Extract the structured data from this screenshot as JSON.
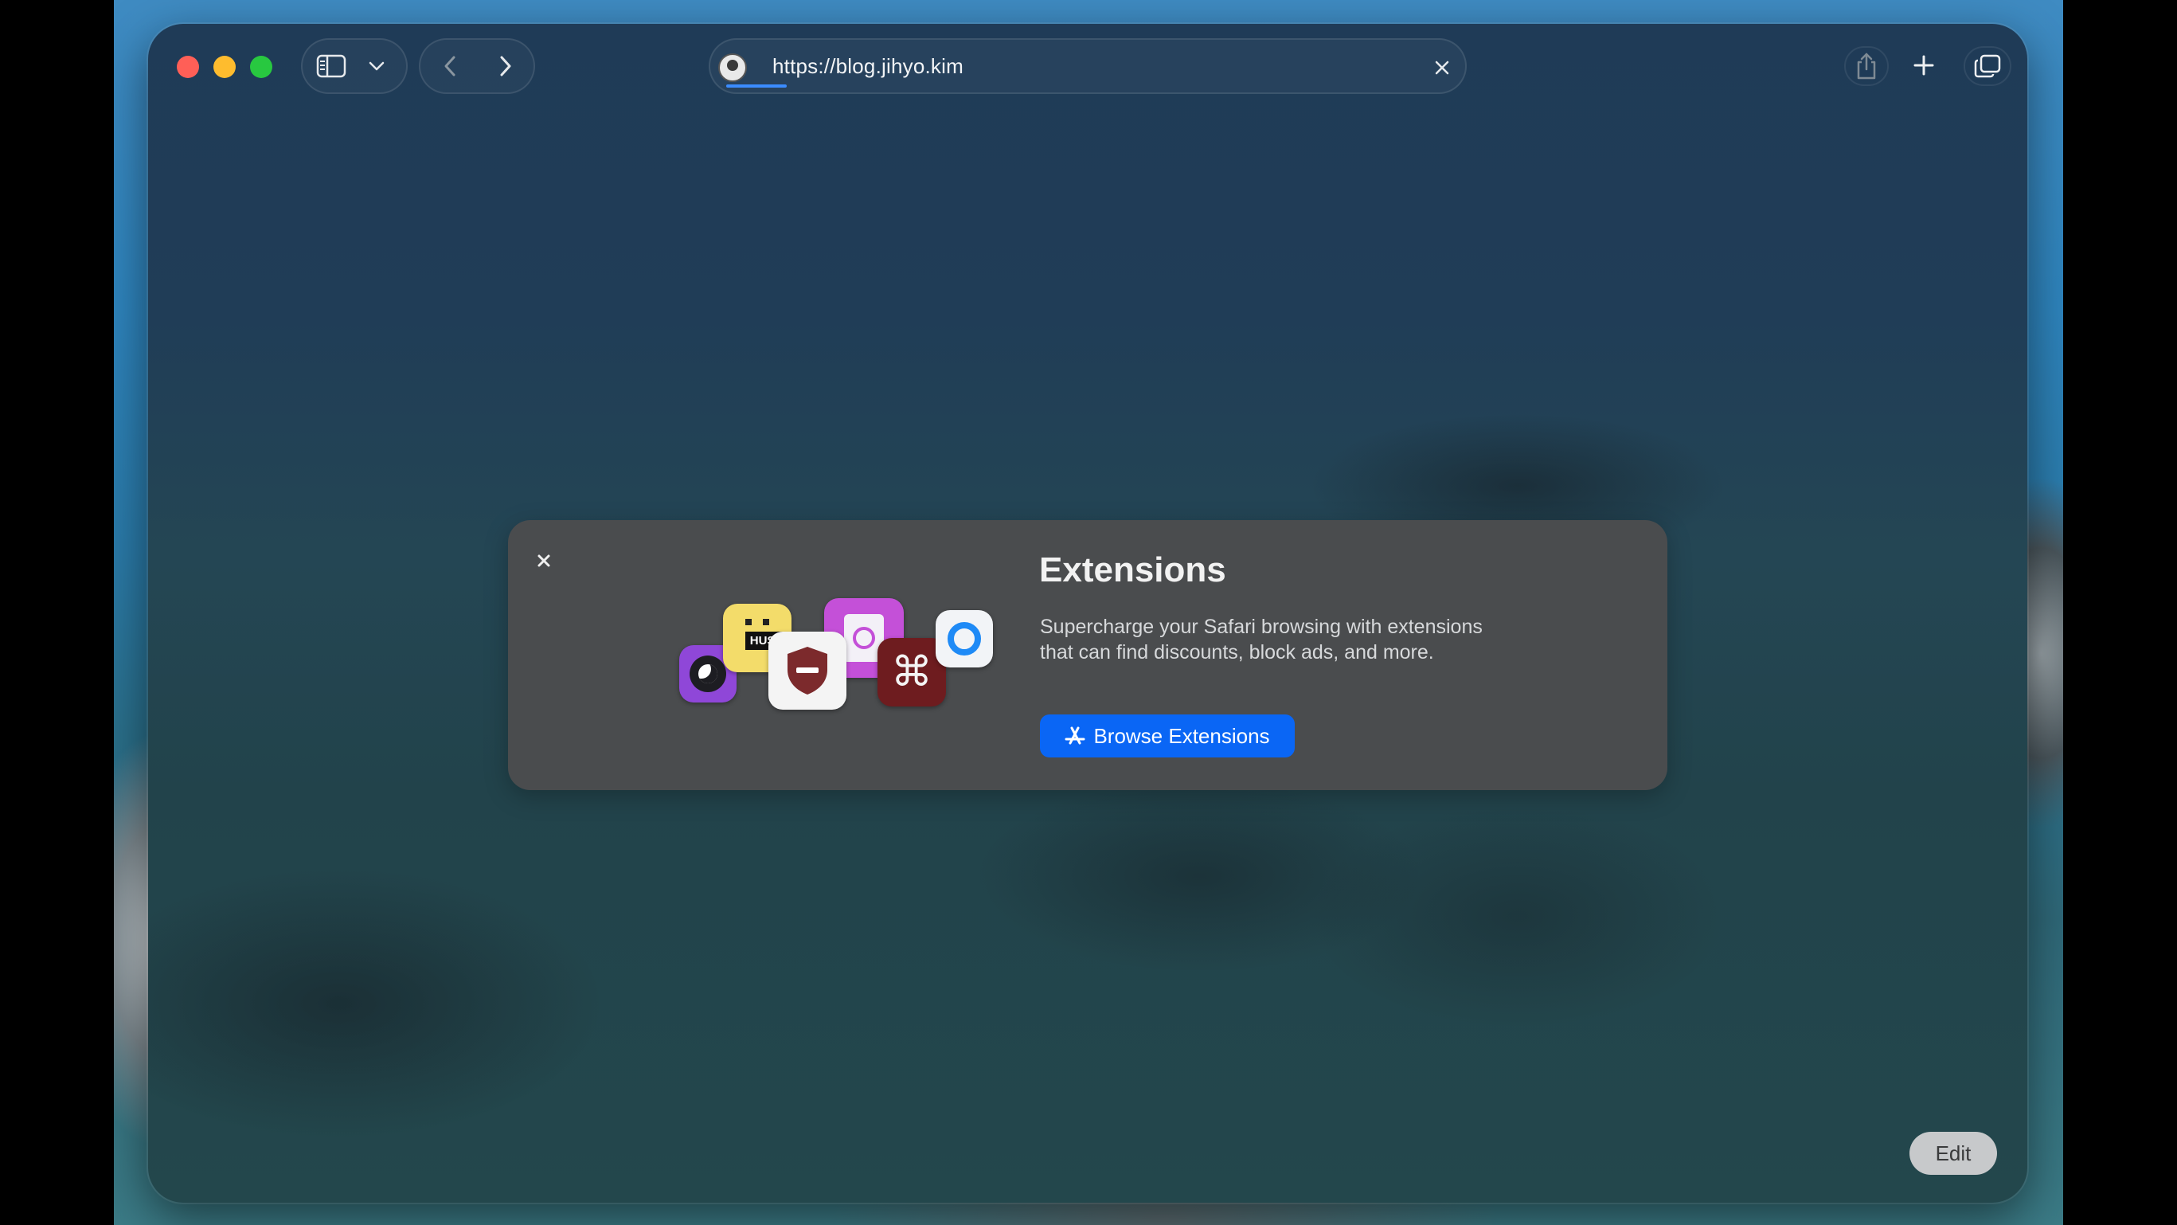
{
  "browser": {
    "url": "https://blog.jihyo.kim"
  },
  "extensions_card": {
    "title": "Extensions",
    "description": "Supercharge your Safari browsing with extensions that can find discounts, block ads, and more.",
    "browse_button_label": "Browse Extensions",
    "icons": [
      "night-mode-icon",
      "hush-icon",
      "shield-icon",
      "clock-bookmark-icon",
      "command-key-icon",
      "blue-circle-icon"
    ],
    "icon_text": "HUSH"
  },
  "start_page": {
    "edit_label": "Edit"
  },
  "colors": {
    "accent": "#0a66f5",
    "close": "#ff5f57",
    "minimize": "#febc2e",
    "zoom": "#28c840"
  }
}
